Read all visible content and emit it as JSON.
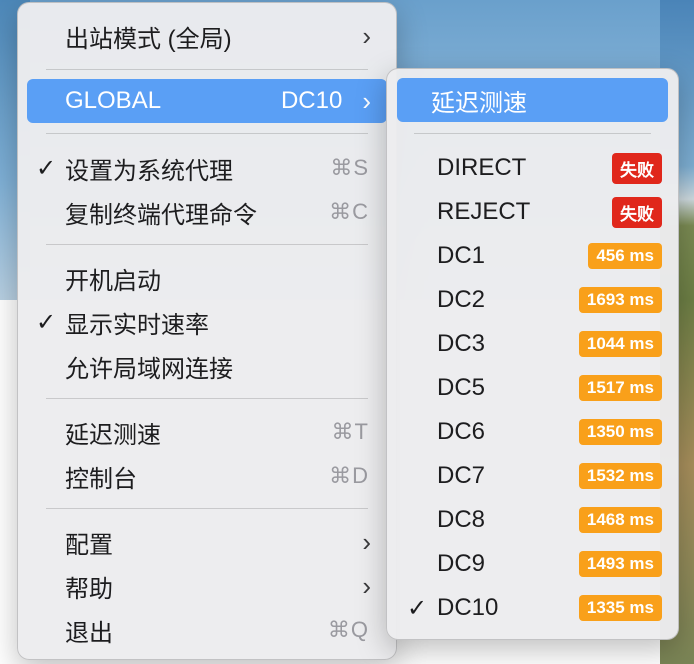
{
  "colors": {
    "highlight": "#5a9ff5",
    "fail_badge": "#e0271b",
    "latency_badge": "#f9a01a"
  },
  "main_menu": {
    "outbound_mode": {
      "label": "出站模式 (全局)",
      "icon": "chevron-right-icon"
    },
    "global": {
      "label": "GLOBAL",
      "detail": "DC10",
      "icon": "chevron-right-icon"
    },
    "set_system_proxy": {
      "check": "✓",
      "label": "设置为系统代理",
      "shortcut": "⌘S"
    },
    "copy_terminal_cmd": {
      "label": "复制终端代理命令",
      "shortcut": "⌘C"
    },
    "launch_at_login": {
      "label": "开机启动"
    },
    "show_speed": {
      "check": "✓",
      "label": "显示实时速率"
    },
    "allow_lan": {
      "label": "允许局域网连接"
    },
    "latency_test": {
      "label": "延迟测速",
      "shortcut": "⌘T"
    },
    "dashboard": {
      "label": "控制台",
      "shortcut": "⌘D"
    },
    "config": {
      "label": "配置",
      "icon": "chevron-right-icon"
    },
    "help": {
      "label": "帮助",
      "icon": "chevron-right-icon"
    },
    "quit": {
      "label": "退出",
      "shortcut": "⌘Q"
    }
  },
  "sub_menu": {
    "latency_test": "延迟测速",
    "items": [
      {
        "label": "DIRECT",
        "badge": "失败",
        "status": "fail"
      },
      {
        "label": "REJECT",
        "badge": "失败",
        "status": "fail"
      },
      {
        "label": "DC1",
        "badge": "456 ms",
        "status": "ok"
      },
      {
        "label": "DC2",
        "badge": "1693 ms",
        "status": "ok"
      },
      {
        "label": "DC3",
        "badge": "1044 ms",
        "status": "ok"
      },
      {
        "label": "DC5",
        "badge": "1517 ms",
        "status": "ok"
      },
      {
        "label": "DC6",
        "badge": "1350 ms",
        "status": "ok"
      },
      {
        "label": "DC7",
        "badge": "1532 ms",
        "status": "ok"
      },
      {
        "label": "DC8",
        "badge": "1468 ms",
        "status": "ok"
      },
      {
        "label": "DC9",
        "badge": "1493 ms",
        "status": "ok"
      },
      {
        "label": "DC10",
        "badge": "1335 ms",
        "status": "ok",
        "check": "✓"
      }
    ]
  }
}
